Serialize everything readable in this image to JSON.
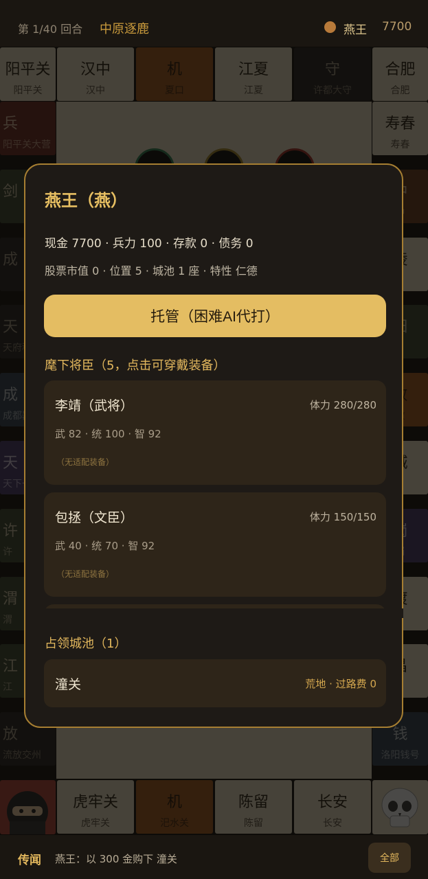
{
  "header": {
    "round": "第 1/40 回合",
    "stage": "中原逐鹿",
    "player": "燕王",
    "money": "7700"
  },
  "board": {
    "top": [
      {
        "name": "阳平关",
        "sub": "阳平关",
        "color": "beige"
      },
      {
        "name": "汉中",
        "sub": "汉中",
        "color": "beige"
      },
      {
        "name": "机",
        "sub": "夏口",
        "color": "orange"
      },
      {
        "name": "江夏",
        "sub": "江夏",
        "color": "beige"
      },
      {
        "name": "守",
        "sub": "许都大守",
        "color": "dark"
      },
      {
        "name": "合肥",
        "sub": "合肥",
        "color": "beige"
      }
    ],
    "left": [
      {
        "name": "兵",
        "sub": "阳平关大营",
        "color": "red"
      },
      {
        "name": "剑",
        "sub": "",
        "color": "green"
      },
      {
        "name": "成",
        "sub": "",
        "color": "dark"
      },
      {
        "name": "天",
        "sub": "天府税",
        "color": "dark"
      },
      {
        "name": "成",
        "sub": "成都器械",
        "color": "navy"
      },
      {
        "name": "天",
        "sub": "天下一",
        "color": "purple"
      },
      {
        "name": "许",
        "sub": "许",
        "color": "green"
      },
      {
        "name": "渭",
        "sub": "渭",
        "color": "green"
      },
      {
        "name": "江",
        "sub": "江",
        "color": "green"
      },
      {
        "name": "放",
        "sub": "流放交州",
        "color": "dark"
      }
    ],
    "right": [
      {
        "name": "寿春",
        "sub": "寿春",
        "color": "beige"
      },
      {
        "name": "中",
        "sub": "中",
        "color": "brown"
      },
      {
        "name": "陵",
        "sub": "",
        "color": "beige"
      },
      {
        "name": "阳",
        "sub": "",
        "color": "green"
      },
      {
        "name": "败",
        "sub": "败",
        "color": "orange"
      },
      {
        "name": "城",
        "sub": "",
        "color": "beige"
      },
      {
        "name": "岗",
        "sub": "岗",
        "color": "purple"
      },
      {
        "name": "渡",
        "sub": "",
        "color": "beige"
      },
      {
        "name": "昌",
        "sub": "",
        "color": "beige"
      },
      {
        "name": "钱",
        "sub": "洛阳钱号",
        "color": "navy"
      }
    ],
    "bottom": [
      {
        "name": "虎牢关",
        "sub": "虎牢关",
        "color": "beige"
      },
      {
        "name": "机",
        "sub": "汜水关",
        "color": "orange"
      },
      {
        "name": "陈留",
        "sub": "陈留",
        "color": "beige"
      },
      {
        "name": "长安",
        "sub": "长安",
        "color": "beige"
      }
    ]
  },
  "modal": {
    "title": "燕王（燕）",
    "stats_line1": "现金 7700 · 兵力 100 · 存款 0 · 债务 0",
    "stats_line2": "股票市值 0 · 位置 5 · 城池 1 座 · 特性 仁德",
    "auto_button": "托管（困难AI代打）",
    "generals_title": "麾下将臣（5，点击可穿戴装备）",
    "generals": [
      {
        "name": "李靖（武将）",
        "hp": "体力 280/280",
        "attrs": "武 82 · 统 100 · 智 92",
        "equip": "（无适配装备）"
      },
      {
        "name": "包拯（文臣）",
        "hp": "体力 150/150",
        "attrs": "武 40 · 统 70 · 智 92",
        "equip": "（无适配装备）"
      }
    ],
    "cities_title": "占领城池（1）",
    "cities": [
      {
        "name": "潼关",
        "info": "荒地 · 过路费 0"
      }
    ]
  },
  "footer": {
    "news_label": "传闻",
    "news_text": "燕王：以 300 金购下 潼关",
    "all_button": "全部"
  },
  "colors": {
    "accent": "#e4bd62",
    "modal_bg": "#1e1a16",
    "modal_border": "#a77f32"
  }
}
